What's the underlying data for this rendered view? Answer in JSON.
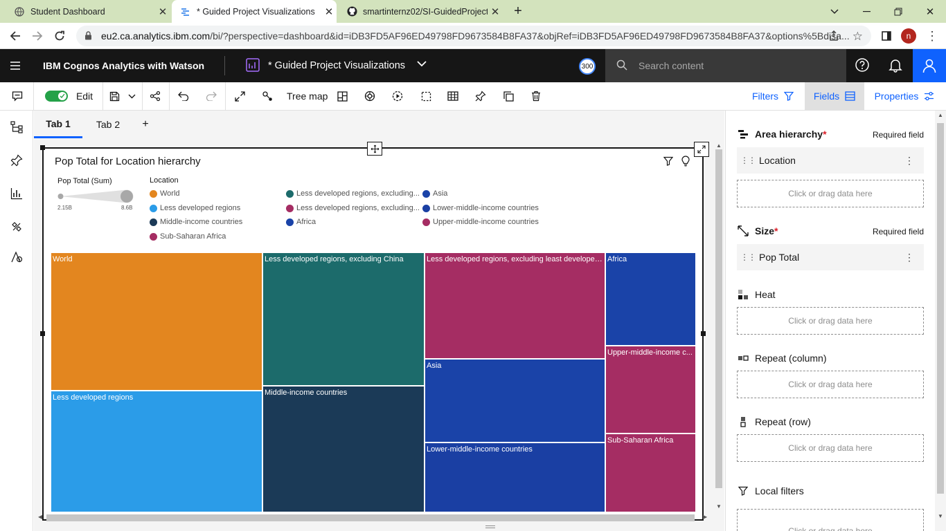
{
  "browser": {
    "tabs": [
      {
        "title": "Student Dashboard"
      },
      {
        "title": "* Guided Project Visualizations"
      },
      {
        "title": "smartinternz02/SI-GuidedProject"
      }
    ],
    "url_domain": "eu2.ca.analytics.ibm.com",
    "url_path": "/bi/?perspective=dashboard&id=iDB3FD5AF96ED49798FD9673584B8FA37&objRef=iDB3FD5AF96ED49798FD9673584B8FA37&options%5Bdisa...",
    "profile_initial": "n"
  },
  "app": {
    "product": "IBM Cognos Analytics with Watson",
    "doc_title": "* Guided Project Visualizations",
    "badge": "300",
    "search_placeholder": "Search content"
  },
  "toolbar": {
    "edit_label": "Edit",
    "edit_on": true,
    "viz_type": "Tree map",
    "filters_label": "Filters",
    "fields_label": "Fields",
    "properties_label": "Properties"
  },
  "canvas_tabs": [
    {
      "label": "Tab 1",
      "active": true
    },
    {
      "label": "Tab 2",
      "active": false
    }
  ],
  "add_tab": "+",
  "widget": {
    "title": "Pop Total for Location hierarchy",
    "size_legend": {
      "title": "Pop Total (Sum)",
      "min": "2.15B",
      "max": "8.6B"
    },
    "color_legend_title": "Location"
  },
  "chart_data": {
    "type": "treemap",
    "title": "Pop Total for Location hierarchy",
    "legend": [
      {
        "name": "World",
        "color": "#e3861f"
      },
      {
        "name": "Less developed regions",
        "color": "#2b9ce8"
      },
      {
        "name": "Less developed regions, excluding...",
        "color": "#1c6b6b"
      },
      {
        "name": "Middle-income countries",
        "color": "#1b3a57"
      },
      {
        "name": "Less developed regions, excluding...",
        "color": "#a52d63"
      },
      {
        "name": "Asia",
        "color": "#1a43a8"
      },
      {
        "name": "Lower-middle-income countries",
        "color": "#1a3fa3"
      },
      {
        "name": "Africa",
        "color": "#1a43a8"
      },
      {
        "name": "Upper-middle-income countries",
        "color": "#a52d63"
      },
      {
        "name": "Sub-Saharan Africa",
        "color": "#a52d63"
      }
    ],
    "tiles": [
      {
        "label": "World",
        "color": "#e3861f"
      },
      {
        "label": "Less developed regions",
        "color": "#2b9ce8"
      },
      {
        "label": "Less developed regions, excluding China",
        "color": "#1c6b6b"
      },
      {
        "label": "Middle-income countries",
        "color": "#1b3a57"
      },
      {
        "label": "Less developed regions, excluding least developed ...",
        "color": "#a52d63"
      },
      {
        "label": "Asia",
        "color": "#1a43a8"
      },
      {
        "label": "Lower-middle-income countries",
        "color": "#1a3fa3"
      },
      {
        "label": "Africa",
        "color": "#1a43a8"
      },
      {
        "label": "Upper-middle-income c...",
        "color": "#a52d63"
      },
      {
        "label": "Sub-Saharan Africa",
        "color": "#a52d63"
      }
    ]
  },
  "fields_panel": {
    "area_hierarchy": {
      "title": "Area hierarchy",
      "required": "Required field",
      "value": "Location"
    },
    "size": {
      "title": "Size",
      "required": "Required field",
      "value": "Pop Total"
    },
    "heat": {
      "title": "Heat"
    },
    "repeat_column": {
      "title": "Repeat (column)"
    },
    "repeat_row": {
      "title": "Repeat (row)"
    },
    "local_filters": {
      "title": "Local filters"
    },
    "drop_hint": "Click or drag data here",
    "asterisk": "*"
  }
}
